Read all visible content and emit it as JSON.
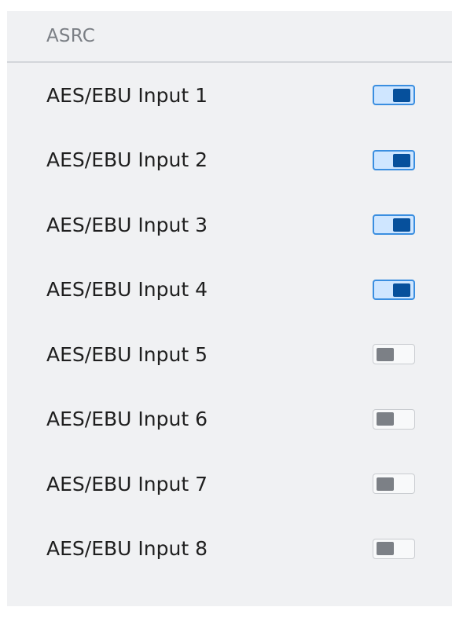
{
  "header": {
    "title": "ASRC"
  },
  "rows": [
    {
      "label": "AES/EBU Input 1",
      "enabled": true
    },
    {
      "label": "AES/EBU Input 2",
      "enabled": true
    },
    {
      "label": "AES/EBU Input 3",
      "enabled": true
    },
    {
      "label": "AES/EBU Input 4",
      "enabled": true
    },
    {
      "label": "AES/EBU Input 5",
      "enabled": false
    },
    {
      "label": "AES/EBU Input 6",
      "enabled": false
    },
    {
      "label": "AES/EBU Input 7",
      "enabled": false
    },
    {
      "label": "AES/EBU Input 8",
      "enabled": false
    }
  ],
  "colors": {
    "toggle_on_track": "#cfe6ff",
    "toggle_on_border": "#3a8ee0",
    "toggle_on_knob": "#06509c",
    "toggle_off_track": "#f8f9fa",
    "toggle_off_knob": "#7c8086"
  }
}
